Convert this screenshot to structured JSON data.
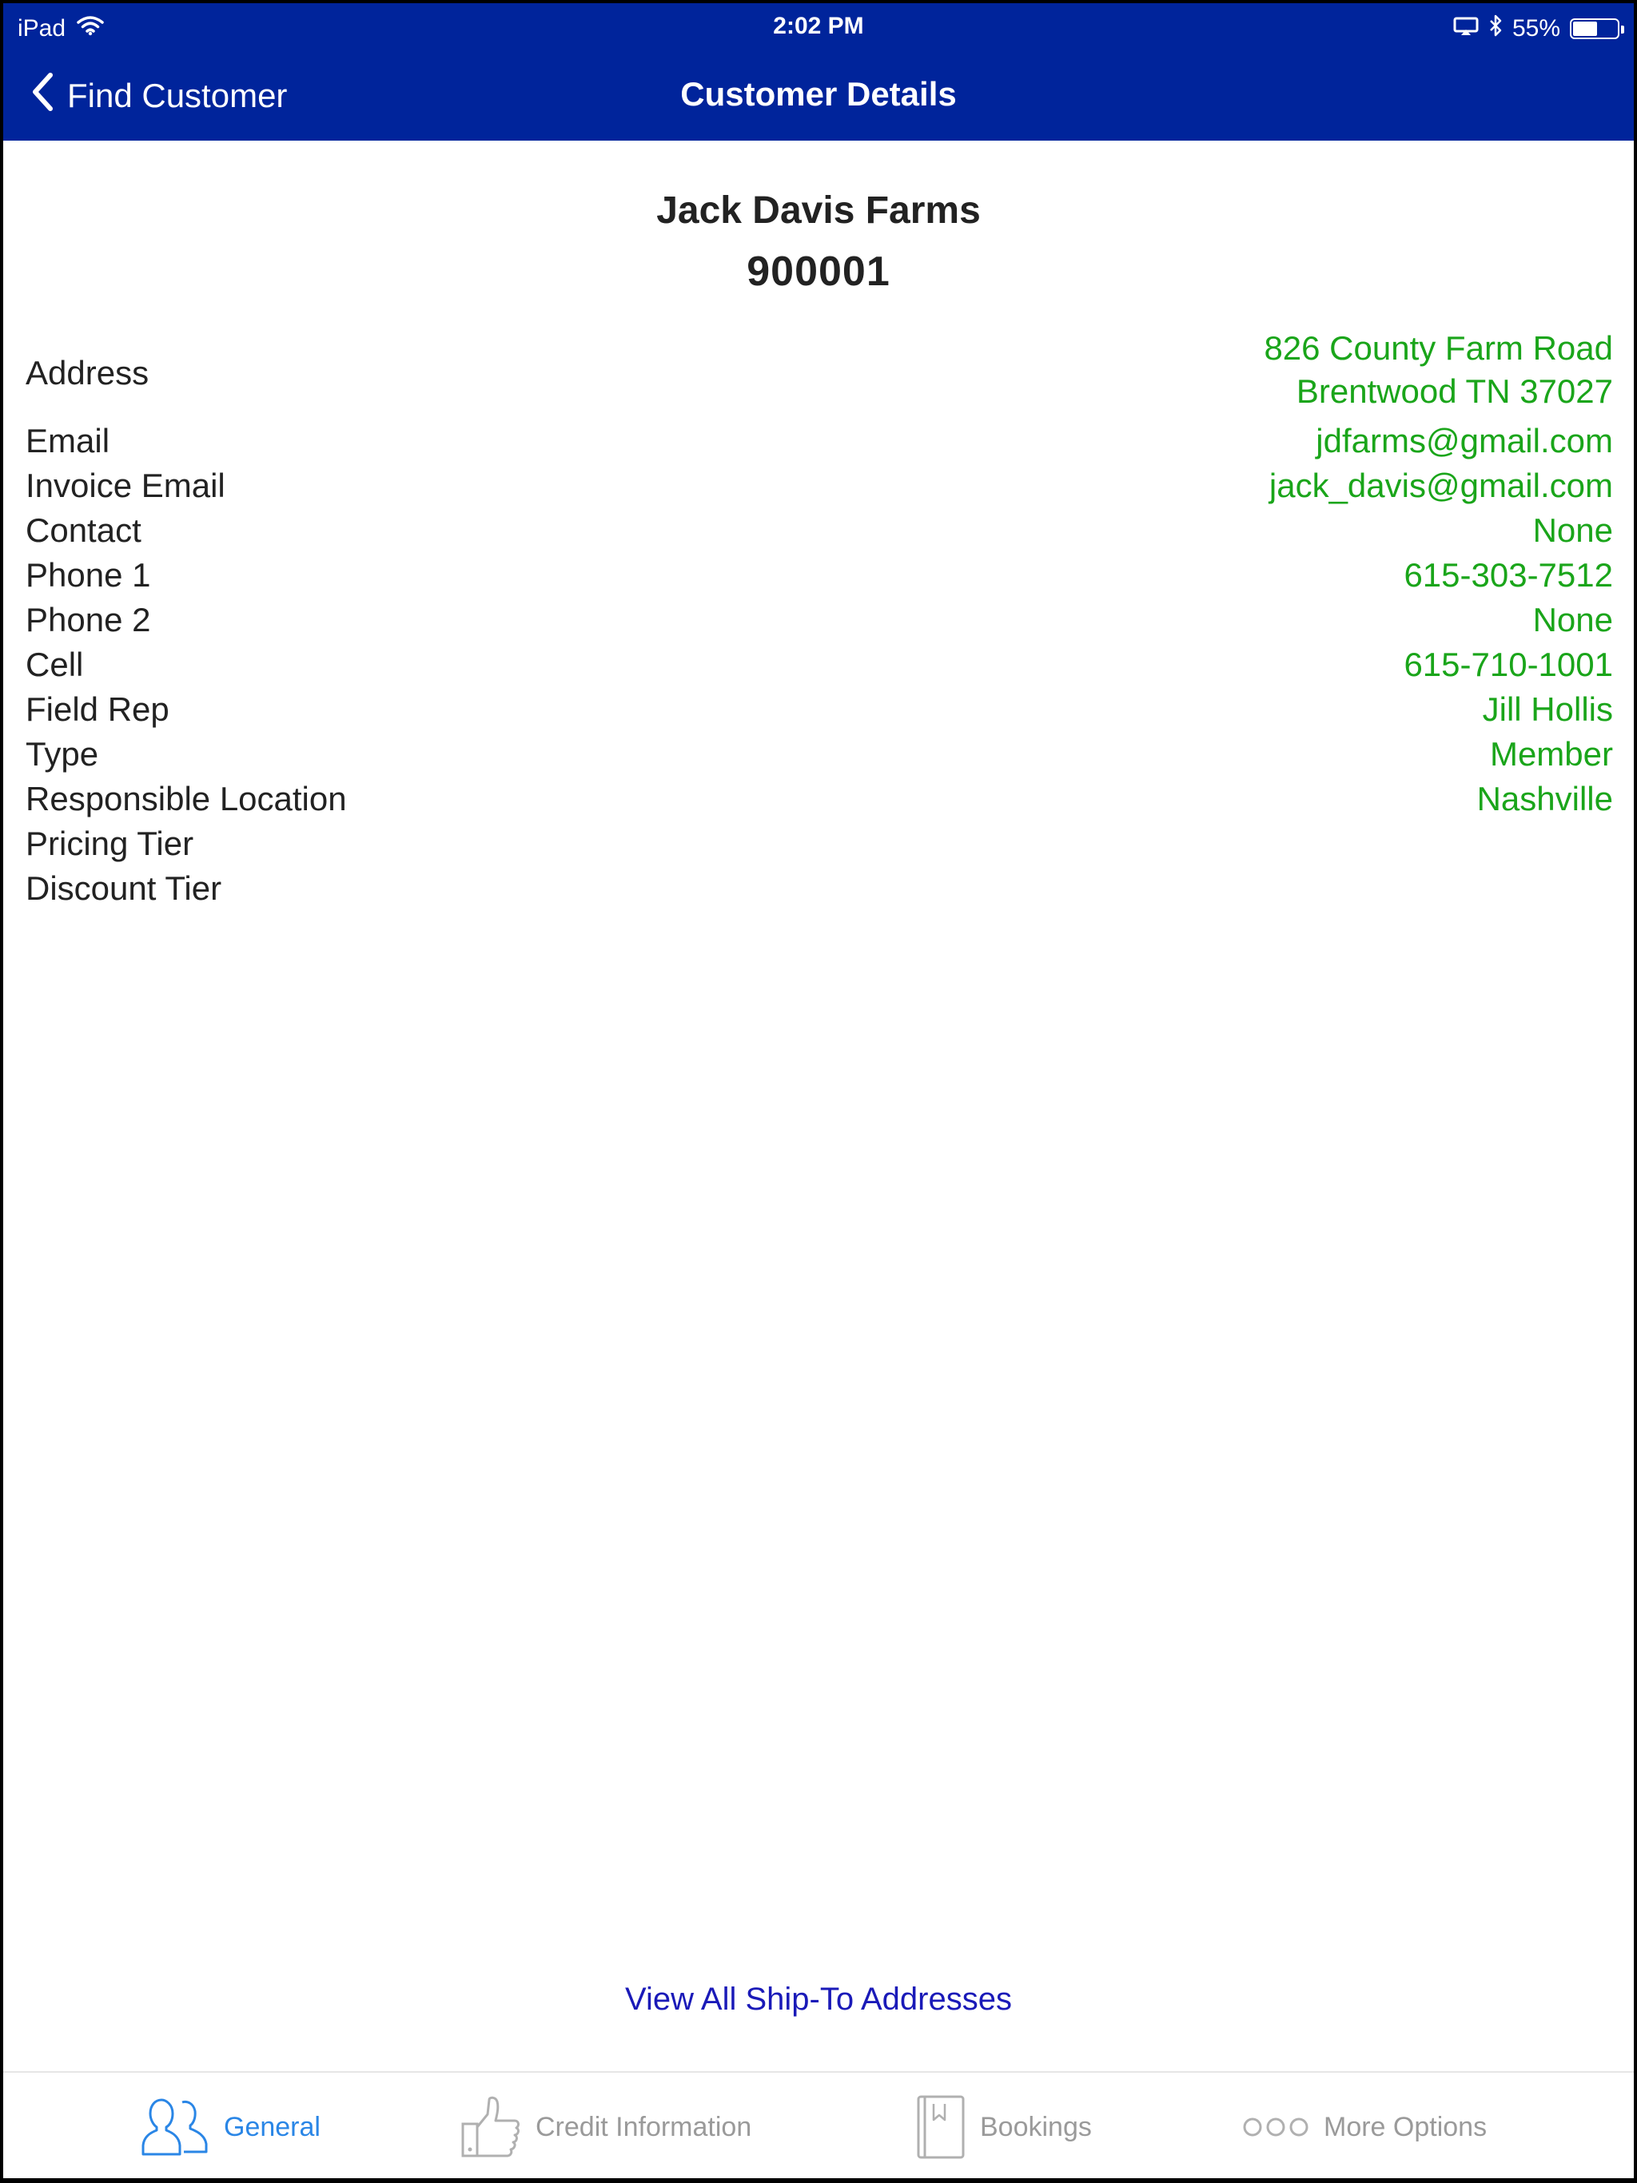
{
  "status_bar": {
    "device": "iPad",
    "time": "2:02 PM",
    "battery": "55%",
    "battery_level": 0.55
  },
  "nav": {
    "back_label": "Find Customer",
    "title": "Customer Details"
  },
  "customer": {
    "name": "Jack Davis Farms",
    "number": "900001"
  },
  "details": {
    "address_label": "Address",
    "address_line1": "826 County Farm Road",
    "address_line2": "Brentwood TN 37027",
    "rows": [
      {
        "label": "Email",
        "value": "jdfarms@gmail.com"
      },
      {
        "label": "Invoice Email",
        "value": "jack_davis@gmail.com"
      },
      {
        "label": "Contact",
        "value": "None"
      },
      {
        "label": "Phone 1",
        "value": "615-303-7512"
      },
      {
        "label": "Phone 2",
        "value": "None"
      },
      {
        "label": "Cell",
        "value": "615-710-1001"
      },
      {
        "label": "Field Rep",
        "value": "Jill Hollis"
      },
      {
        "label": "Type",
        "value": "Member"
      },
      {
        "label": "Responsible Location",
        "value": "Nashville"
      },
      {
        "label": "Pricing Tier",
        "value": ""
      },
      {
        "label": "Discount Tier",
        "value": ""
      }
    ]
  },
  "links": {
    "ship_to": "View All Ship-To Addresses"
  },
  "tabs": [
    {
      "label": "General",
      "icon": "people-icon",
      "active": true
    },
    {
      "label": "Credit Information",
      "icon": "thumbs-up-icon",
      "active": false
    },
    {
      "label": "Bookings",
      "icon": "book-icon",
      "active": false
    },
    {
      "label": "More Options",
      "icon": "more-dots-icon",
      "active": false
    }
  ],
  "colors": {
    "nav_bar": "#00249b",
    "value_text": "#1aa51a",
    "link_text": "#1a1ab8",
    "active_tab": "#2a86e6",
    "inactive_tab": "#9a9a9a"
  }
}
